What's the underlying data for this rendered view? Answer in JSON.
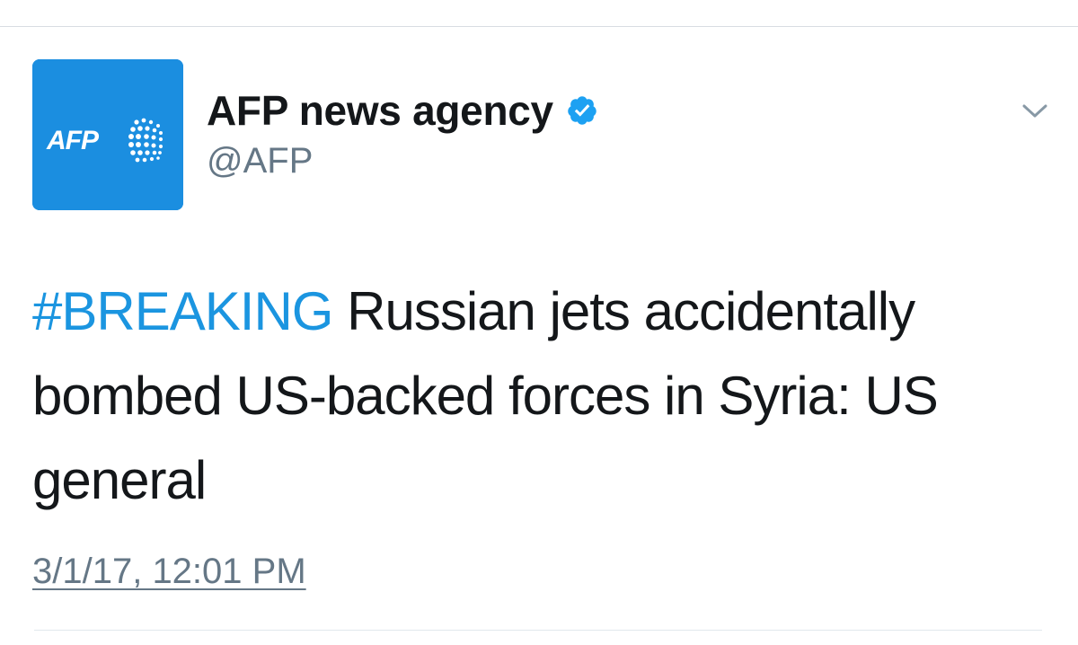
{
  "tweet": {
    "author": {
      "display_name": "AFP news agency",
      "handle": "@AFP",
      "verified": true,
      "avatar_logo_text": "AFP",
      "avatar_bg": "#1b8ee0"
    },
    "menu_icon": "chevron-down-icon",
    "text": {
      "hashtag": "#BREAKING",
      "body": "Russian jets accidentally bombed US-backed forces in Syria: US general"
    },
    "timestamp": "3/1/17, 12:01 PM"
  },
  "colors": {
    "link": "#1b95e0",
    "text": "#14171a",
    "secondary": "#657786",
    "verified_badge": "#1da1f2"
  }
}
